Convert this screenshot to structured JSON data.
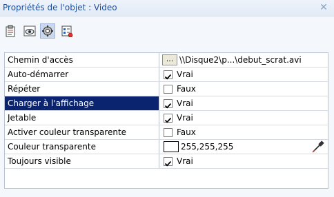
{
  "window": {
    "title": "Propriétés de l'objet : Video",
    "close_icon": "close-icon"
  },
  "toolbar": {
    "buttons": [
      {
        "icon": "clipboard-icon",
        "active": false
      },
      {
        "icon": "eye-icon",
        "active": false
      },
      {
        "icon": "gear-icon",
        "active": true
      },
      {
        "icon": "checklist-icon",
        "active": false
      }
    ]
  },
  "properties": [
    {
      "name": "Chemin d'accès",
      "type": "path",
      "button_label": "...",
      "value": "\\\\Disque2\\p...\\debut_scrat.avi"
    },
    {
      "name": "Auto-démarrer",
      "type": "bool",
      "checked": true,
      "value": "Vrai"
    },
    {
      "name": "Répéter",
      "type": "bool",
      "checked": false,
      "value": "Faux"
    },
    {
      "name": "Charger à l'affichage",
      "type": "bool",
      "checked": true,
      "value": "Vrai",
      "selected": true
    },
    {
      "name": "Jetable",
      "type": "bool",
      "checked": true,
      "value": "Vrai"
    },
    {
      "name": "Activer couleur transparente",
      "type": "bool",
      "checked": false,
      "value": "Faux"
    },
    {
      "name": "Couleur transparente",
      "type": "color",
      "swatch": "#ffffff",
      "value": "255,255,255"
    },
    {
      "name": "Toujours visible",
      "type": "bool",
      "checked": true,
      "value": "Vrai"
    }
  ],
  "colors": {
    "selected_bg": "#0a2470",
    "title_text": "#1c4f99",
    "grid_line": "#d4d9e2"
  }
}
